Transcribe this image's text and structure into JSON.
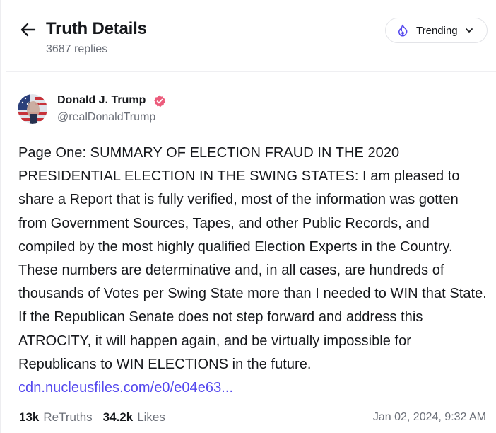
{
  "header": {
    "title": "Truth Details",
    "reply_count": "3687 replies",
    "back_icon": "arrow-left-icon",
    "sort": {
      "label": "Trending",
      "icon": "flame-icon",
      "chevron": "chevron-down-icon"
    }
  },
  "post": {
    "author": {
      "name": "Donald J. Trump",
      "handle": "@realDonaldTrump",
      "verified_icon": "verified-badge-icon"
    },
    "text": "Page One: SUMMARY OF ELECTION FRAUD IN THE 2020 PRESIDENTIAL ELECTION IN THE SWING STATES: I am pleased to share a Report that is fully verified, most of the information was gotten from Government Sources, Tapes, and other Public Records, and compiled by the most highly qualified Election Experts in the Country. These numbers are determinative and, in all cases, are hundreds of thousands of Votes per Swing State more than I needed to WIN that State. If the Republican Senate does not step forward and address this ATROCITY, it will happen again, and be virtually impossible for Republicans to WIN ELECTIONS in the future.",
    "link": "cdn.nucleusfiles.com/e0/e04e63...",
    "stats": {
      "retruths_count": "13k",
      "retruths_label": "ReTruths",
      "likes_count": "34.2k",
      "likes_label": "Likes"
    },
    "timestamp": "Jan 02, 2024, 9:32 AM"
  },
  "colors": {
    "accent": "#5448ee",
    "verified": "#ec5b7b",
    "muted_text": "#6b6f78"
  }
}
